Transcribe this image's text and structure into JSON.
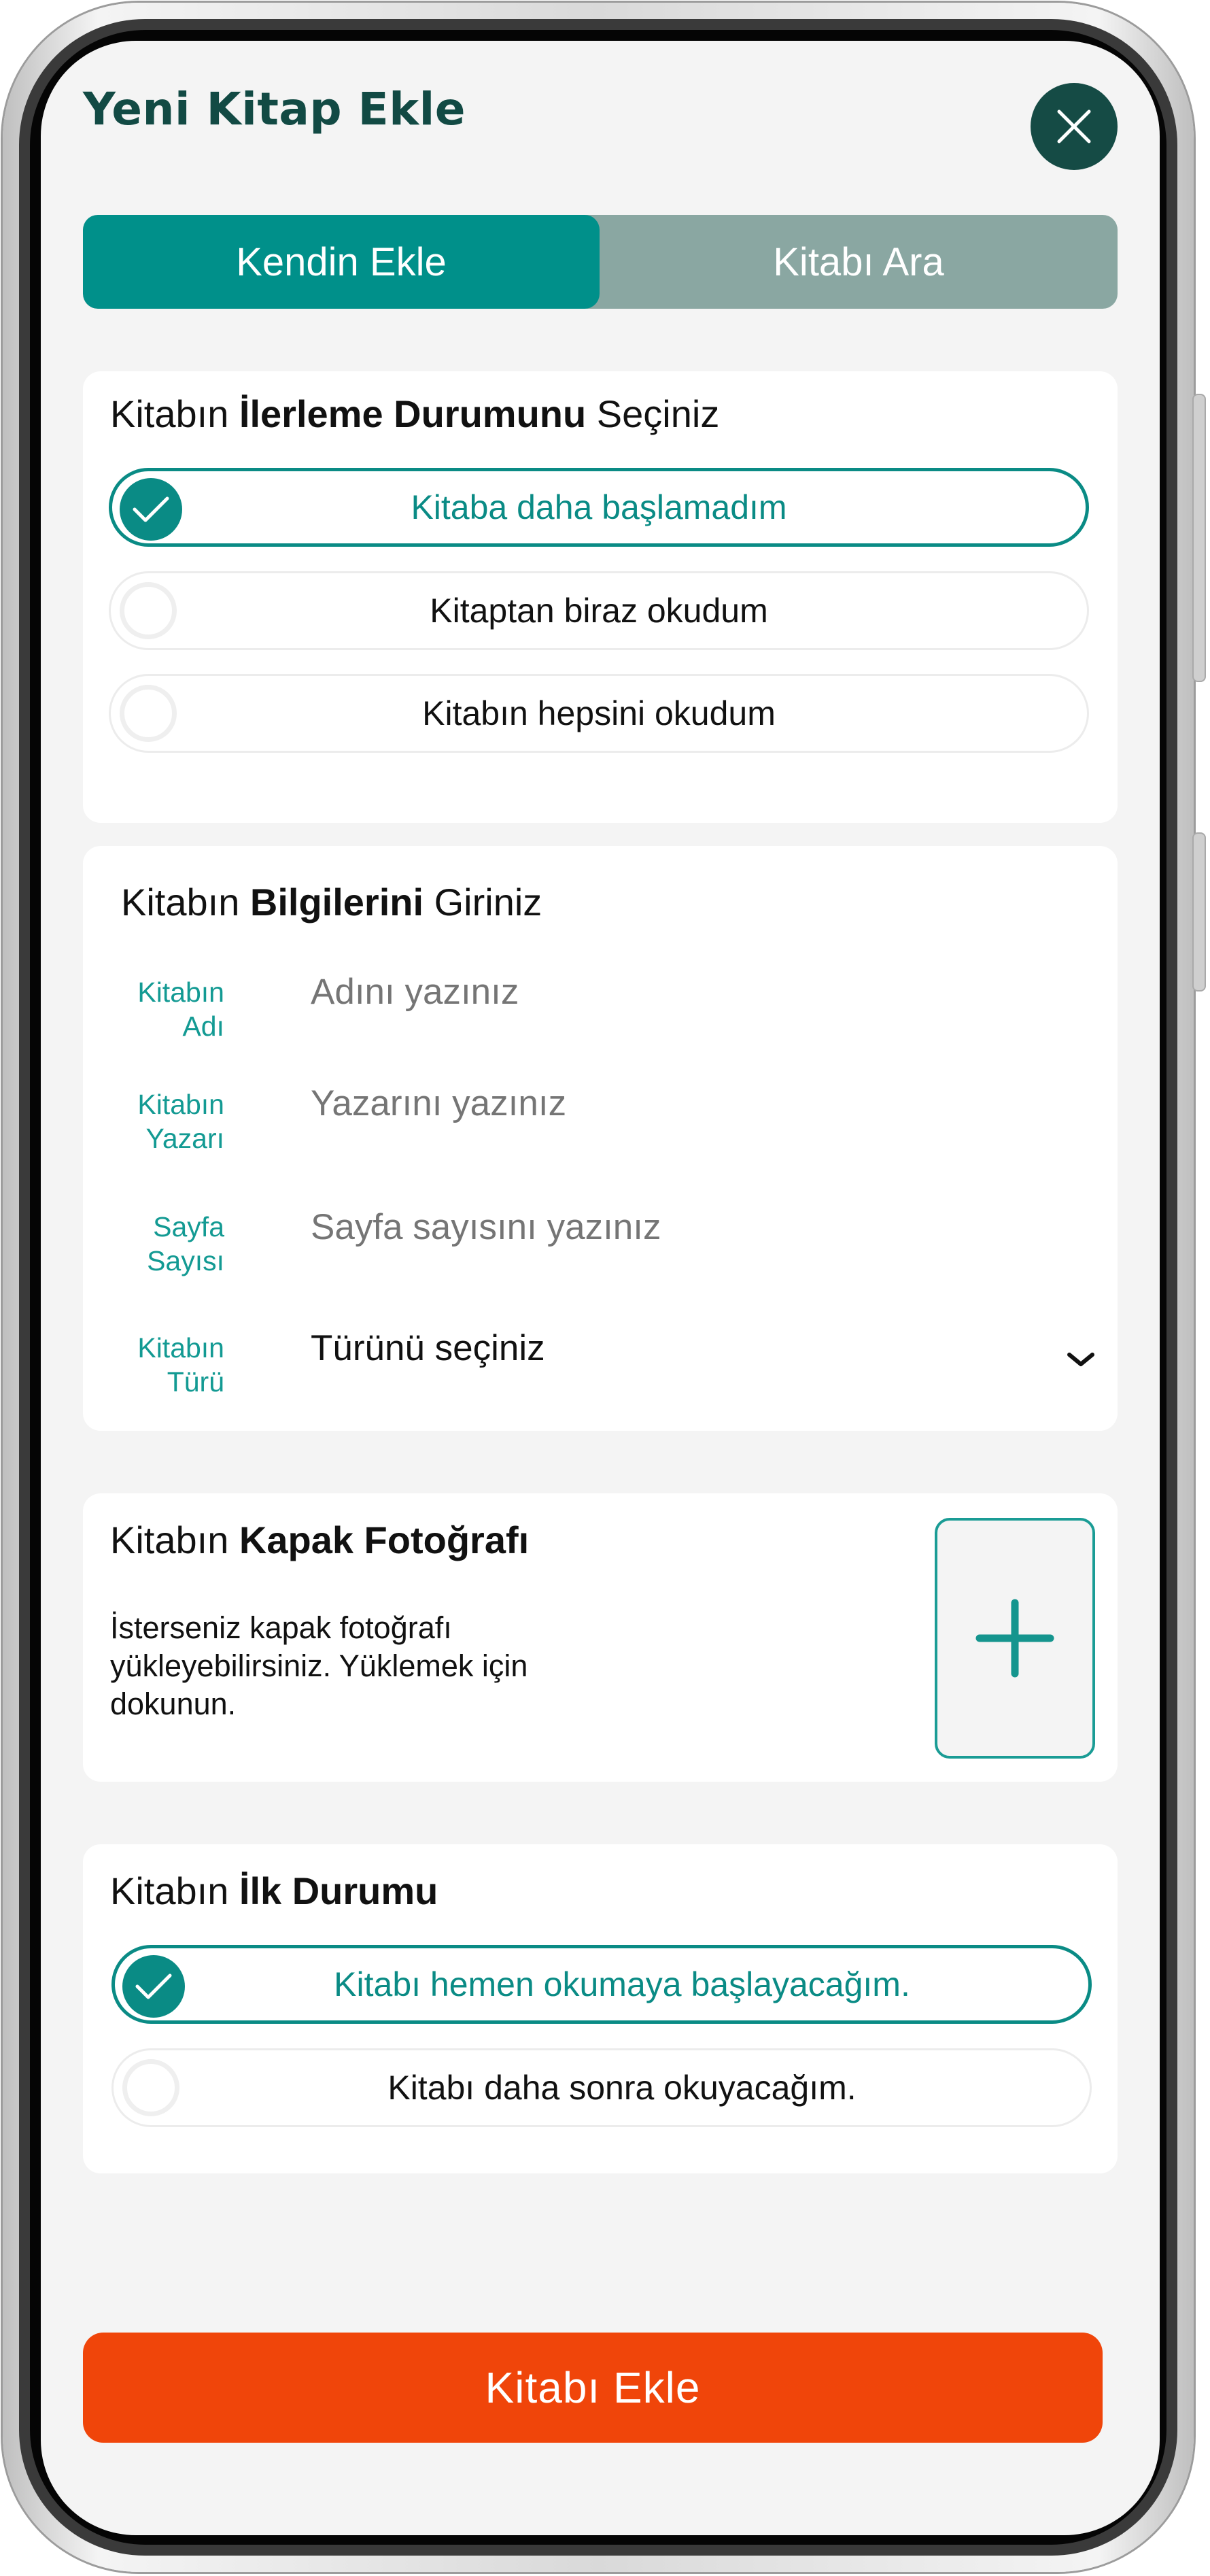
{
  "header": {
    "title": "Yeni Kitap Ekle",
    "close_icon": "close-icon"
  },
  "tabs": [
    {
      "label": "Kendin Ekle",
      "active": true
    },
    {
      "label": "Kitabı Ara",
      "active": false
    }
  ],
  "progress_section": {
    "title_pre": "Kitabın ",
    "title_bold": "İlerleme Durumunu",
    "title_post": " Seçiniz",
    "options": [
      {
        "label": "Kitaba daha başlamadım",
        "selected": true
      },
      {
        "label": "Kitaptan biraz okudum",
        "selected": false
      },
      {
        "label": "Kitabın hepsini okudum",
        "selected": false
      }
    ]
  },
  "info_section": {
    "title_pre": "Kitabın ",
    "title_bold": "Bilgilerini",
    "title_post": " Giriniz",
    "fields": [
      {
        "label_line1": "Kitabın",
        "label_line2": "Adı",
        "placeholder": "Adını yazınız"
      },
      {
        "label_line1": "Kitabın",
        "label_line2": "Yazarı",
        "placeholder": "Yazarını yazınız"
      },
      {
        "label_line1": "Sayfa",
        "label_line2": "Sayısı",
        "placeholder": "Sayfa sayısını yazınız"
      },
      {
        "label_line1": "Kitabın",
        "label_line2": "Türü",
        "placeholder": "Türünü seçiniz"
      }
    ]
  },
  "cover_section": {
    "title_pre": "Kitabın ",
    "title_bold": "Kapak Fotoğrafı",
    "description": "İsterseniz kapak fotoğrafı yükleyebilirsiniz. Yüklemek için dokunun.",
    "add_icon": "plus-icon"
  },
  "status_section": {
    "title_pre": "Kitabın ",
    "title_bold": "İlk Durumu",
    "options": [
      {
        "label": "Kitabı hemen okumaya başlayacağım.",
        "selected": true
      },
      {
        "label": "Kitabı daha sonra okuyacağım.",
        "selected": false
      }
    ]
  },
  "submit": {
    "label": "Kitabı Ekle"
  },
  "colors": {
    "primary": "#00908a",
    "dark_green": "#154b45",
    "inactive_tab": "#8aa7a2",
    "submit": "#f0450a",
    "background": "#f4f4f4"
  }
}
